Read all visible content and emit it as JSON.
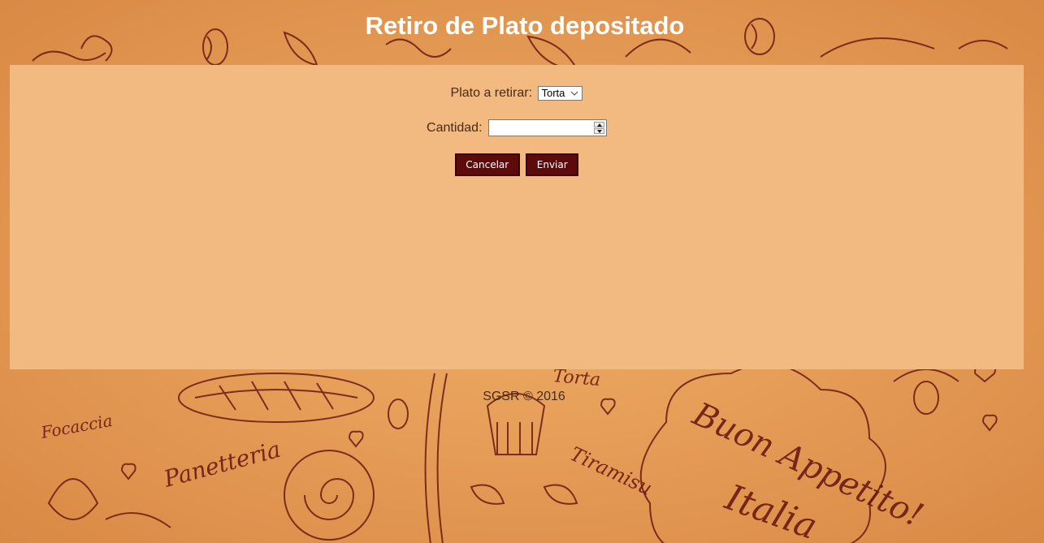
{
  "header": {
    "title": "Retiro de Plato depositado"
  },
  "form": {
    "plato_label": "Plato a retirar:",
    "plato_value": "Torta",
    "cantidad_label": "Cantidad:",
    "cantidad_value": ""
  },
  "buttons": {
    "cancel_label": "Cancelar",
    "send_label": "Enviar"
  },
  "footer": {
    "text": "SGSR © 2016"
  },
  "background": {
    "doodle_texts": [
      "Focaccia",
      "Panetteria",
      "Torta",
      "Tiramisu",
      "Buon Appetito!",
      "Italia"
    ]
  },
  "colors": {
    "background": "#e9a35e",
    "panel": "#f2b981",
    "button": "#5e0a0a",
    "text": "#4a2a12",
    "title": "#ffffff"
  }
}
